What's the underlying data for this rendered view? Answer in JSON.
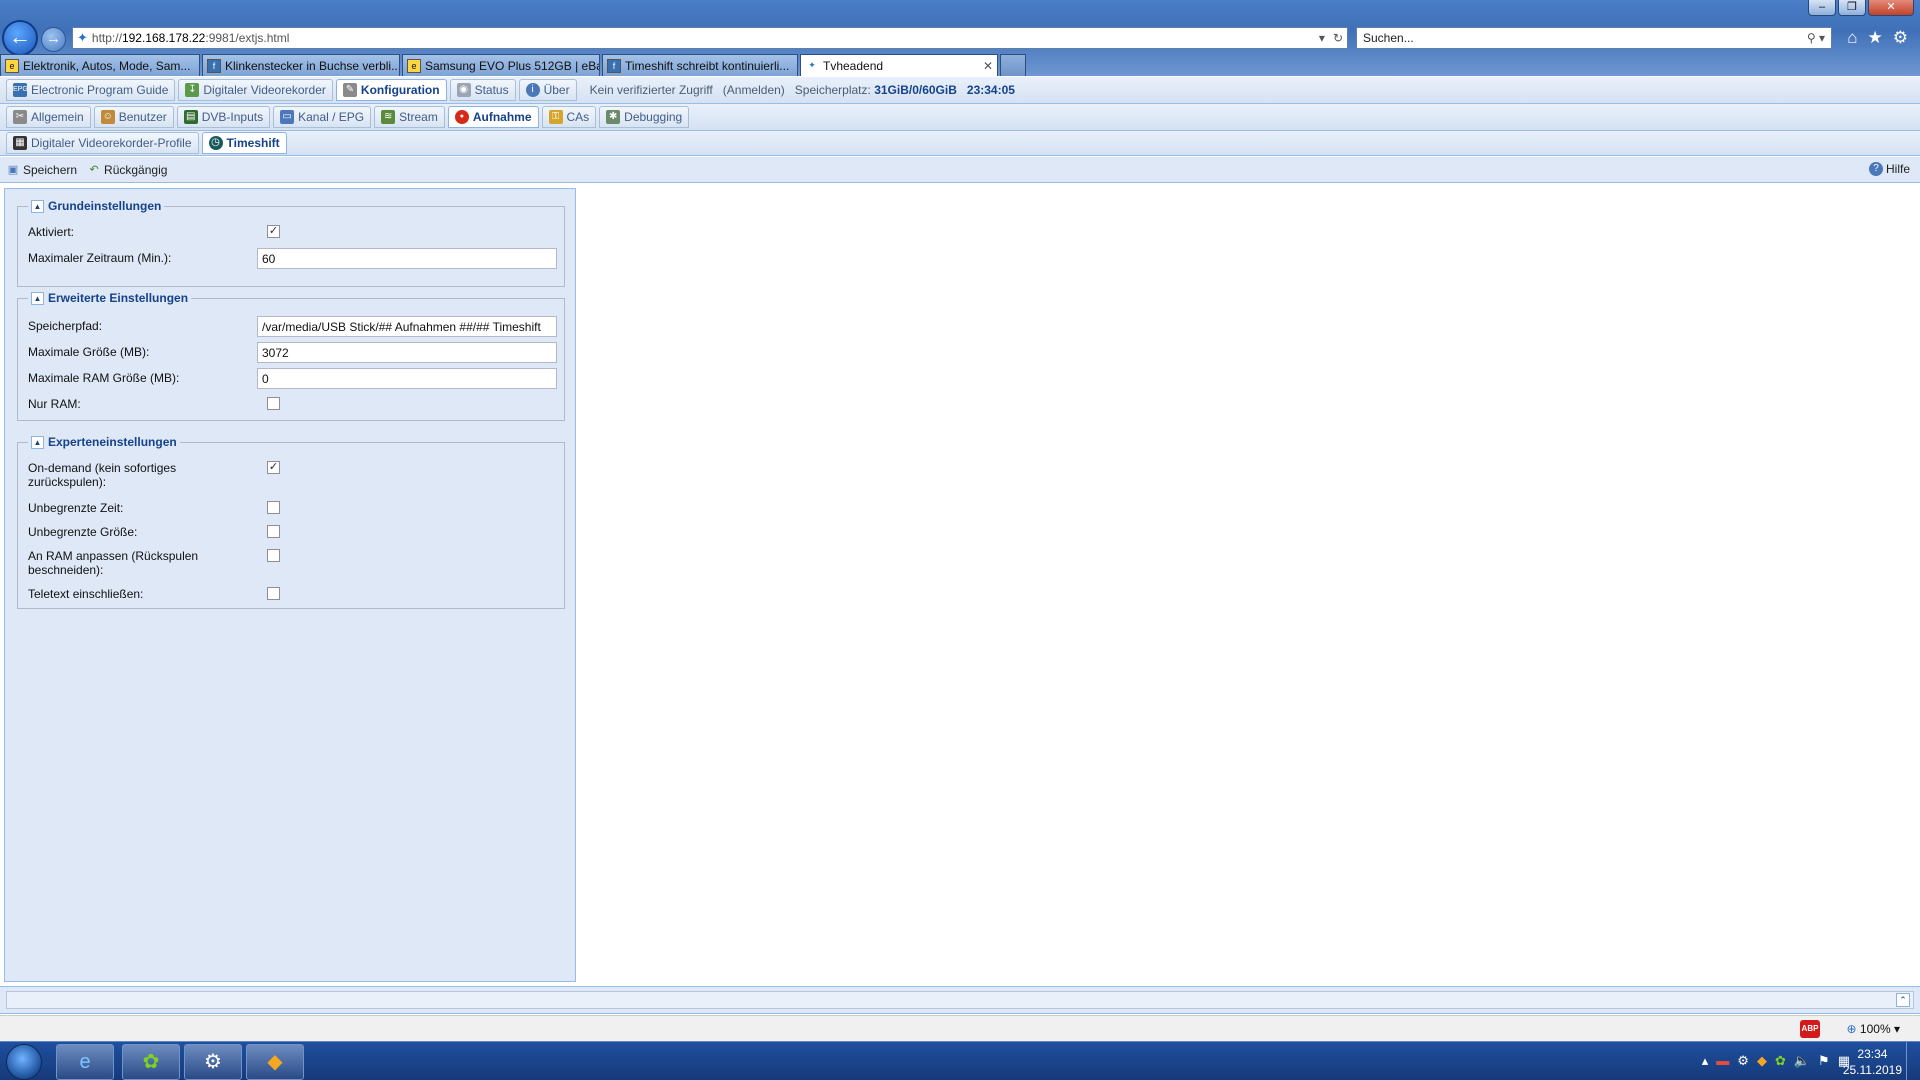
{
  "browser": {
    "address_prefix": "http://",
    "address_host": "192.168.178.22",
    "address_rest": ":9981/extjs.html",
    "search_placeholder": "Suchen...",
    "tabs": [
      {
        "label": "Elektronik, Autos, Mode, Sam...",
        "favicon": "ebay-icon"
      },
      {
        "label": "Klinkenstecker in Buchse verbli...",
        "favicon": "forum-icon"
      },
      {
        "label": "Samsung EVO Plus 512GB | eBay",
        "favicon": "ebay-icon"
      },
      {
        "label": "Timeshift schreibt kontinuierli...",
        "favicon": "forum-icon"
      },
      {
        "label": "Tvheadend",
        "favicon": "tvheadend-icon"
      }
    ]
  },
  "app": {
    "main_tabs": [
      {
        "label": "Electronic Program Guide",
        "icon": "epg-icon"
      },
      {
        "label": "Digitaler Videorekorder",
        "icon": "dvr-icon"
      },
      {
        "label": "Konfiguration",
        "icon": "wrench-icon"
      },
      {
        "label": "Status",
        "icon": "eye-icon"
      },
      {
        "label": "Über",
        "icon": "info-icon"
      }
    ],
    "access_text": "Kein verifizierter Zugriff",
    "login_text": "(Anmelden)",
    "storage_label": "Speicherplatz:",
    "storage_value": "31GiB/0/60GiB",
    "server_time": "23:34:05",
    "sub_tabs": [
      {
        "label": "Allgemein",
        "icon": "tools-icon"
      },
      {
        "label": "Benutzer",
        "icon": "users-icon"
      },
      {
        "label": "DVB-Inputs",
        "icon": "card-icon"
      },
      {
        "label": "Kanal / EPG",
        "icon": "tv-icon"
      },
      {
        "label": "Stream",
        "icon": "stream-icon"
      },
      {
        "label": "Aufnahme",
        "icon": "record-icon"
      },
      {
        "label": "CAs",
        "icon": "key-icon"
      },
      {
        "label": "Debugging",
        "icon": "bug-icon"
      }
    ],
    "sub_tabs2": [
      {
        "label": "Digitaler Videorekorder-Profile",
        "icon": "profile-icon"
      },
      {
        "label": "Timeshift",
        "icon": "timeshift-icon"
      }
    ],
    "actions": {
      "save": "Speichern",
      "undo": "Rückgängig",
      "help": "Hilfe"
    }
  },
  "form": {
    "basic": {
      "legend": "Grundeinstellungen",
      "enabled_label": "Aktiviert:",
      "enabled_checked": true,
      "max_period_label": "Maximaler Zeitraum (Min.):",
      "max_period_value": "60"
    },
    "advanced": {
      "legend": "Erweiterte Einstellungen",
      "path_label": "Speicherpfad:",
      "path_value": "/var/media/USB Stick/## Aufnahmen ##/## Timeshift",
      "max_size_label": "Maximale Größe (MB):",
      "max_size_value": "3072",
      "max_ram_label": "Maximale RAM Größe (MB):",
      "max_ram_value": "0",
      "ram_only_label": "Nur RAM:",
      "ram_only_checked": false
    },
    "expert": {
      "legend": "Experteneinstellungen",
      "on_demand_label": "On-demand (kein sofortiges zurückspulen):",
      "on_demand_checked": true,
      "unlimited_time_label": "Unbegrenzte Zeit:",
      "unlimited_time_checked": false,
      "unlimited_size_label": "Unbegrenzte Größe:",
      "unlimited_size_checked": false,
      "fit_ram_label": "An RAM anpassen (Rückspulen beschneiden):",
      "fit_ram_checked": false,
      "teletext_label": "Teletext einschließen:",
      "teletext_checked": false
    }
  },
  "statusbar": {
    "zoom": "100%",
    "adblock": "ABP"
  },
  "taskbar": {
    "time": "23:34",
    "date": "25.11.2019"
  }
}
